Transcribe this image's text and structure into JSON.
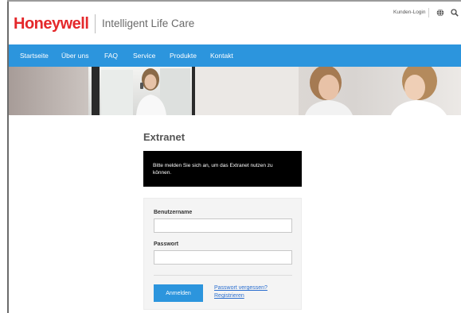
{
  "header": {
    "brand": "Honeywell",
    "tagline": "Intelligent Life Care",
    "login_link": "Kunden-Login",
    "icons": [
      "globe-icon",
      "search-icon"
    ]
  },
  "nav": {
    "items": [
      "Startseite",
      "Über uns",
      "FAQ",
      "Service",
      "Produkte",
      "Kontakt"
    ]
  },
  "main": {
    "title": "Extranet",
    "notice": "Bitte melden Sie sich an, um das Extranet nutzen zu können.",
    "form": {
      "username_label": "Benutzername",
      "username_value": "",
      "password_label": "Passwort",
      "password_value": "",
      "submit_label": "Anmelden",
      "forgot_link": "Passwort vergessen?",
      "register_link": "Registrieren"
    }
  },
  "colors": {
    "brand_red": "#e4282b",
    "nav_blue": "#2c95dd",
    "link_blue": "#2c6fcf",
    "notice_bg": "#000000"
  }
}
